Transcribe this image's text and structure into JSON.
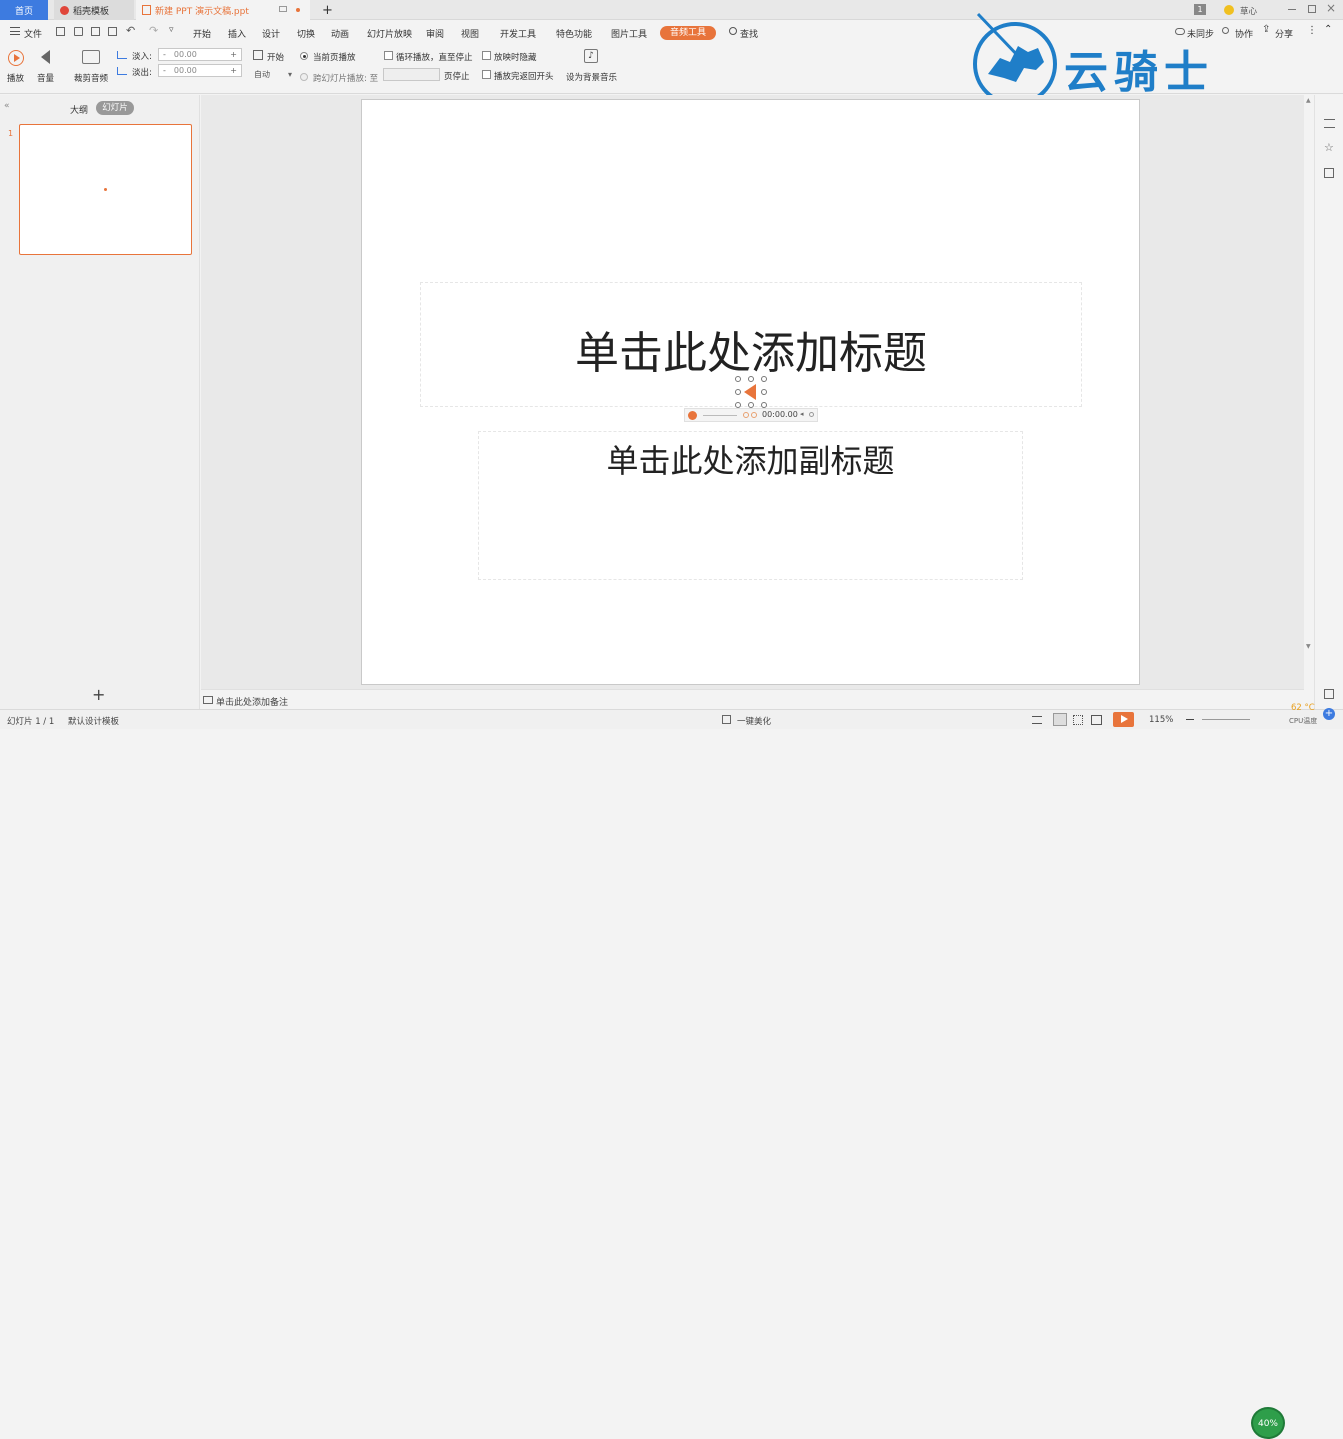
{
  "tabs": {
    "home": "首页",
    "template": "稻壳模板",
    "doc": "新建 PPT 演示文稿.ppt",
    "new_tab": "+"
  },
  "titlebar": {
    "badge": "1",
    "user": "草心"
  },
  "menu": {
    "file": "文件",
    "items": [
      "开始",
      "插入",
      "设计",
      "切换",
      "动画",
      "幻灯片放映",
      "审阅",
      "视图",
      "开发工具",
      "特色功能",
      "图片工具"
    ],
    "active": "音频工具",
    "search": "查找",
    "sync": "未同步",
    "collab": "协作",
    "share": "分享"
  },
  "ribbon": {
    "play": "播放",
    "volume": "音量",
    "trim": "裁剪音频",
    "fade_in": "淡入:",
    "fade_out": "淡出:",
    "fade_in_value": "00.00",
    "fade_out_value": "00.00",
    "start": "开始",
    "start_value": "自动",
    "current_page": "当前页播放",
    "cross_slide": "跨幻灯片播放: 至",
    "stop_page": "页停止",
    "loop": "循环播放，直至停止",
    "hide": "放映时隐藏",
    "rewind": "播放完返回开头",
    "bg_music": "设为背景音乐"
  },
  "watermark": {
    "text": "云骑士"
  },
  "panel": {
    "outline_tab": "大纲",
    "slides_tab": "幻灯片",
    "slide_number": "1",
    "add": "+"
  },
  "slide": {
    "title_placeholder": "单击此处添加标题",
    "subtitle_placeholder": "单击此处添加副标题",
    "audio_time": "00:00.00"
  },
  "notes": {
    "placeholder": "单击此处添加备注"
  },
  "status": {
    "slide_info": "幻灯片 1 / 1",
    "template": "默认设计模板",
    "beautify": "一键美化",
    "zoom": "115%",
    "cpu_percent": "40%",
    "cpu_temp": "62 °C",
    "cpu_label": "CPU温度"
  },
  "colors": {
    "accent": "#e8743b",
    "active_tab": "#e8743b",
    "cpu_green": "#2e9e4a",
    "watermark_blue": "#1f7ec8"
  }
}
